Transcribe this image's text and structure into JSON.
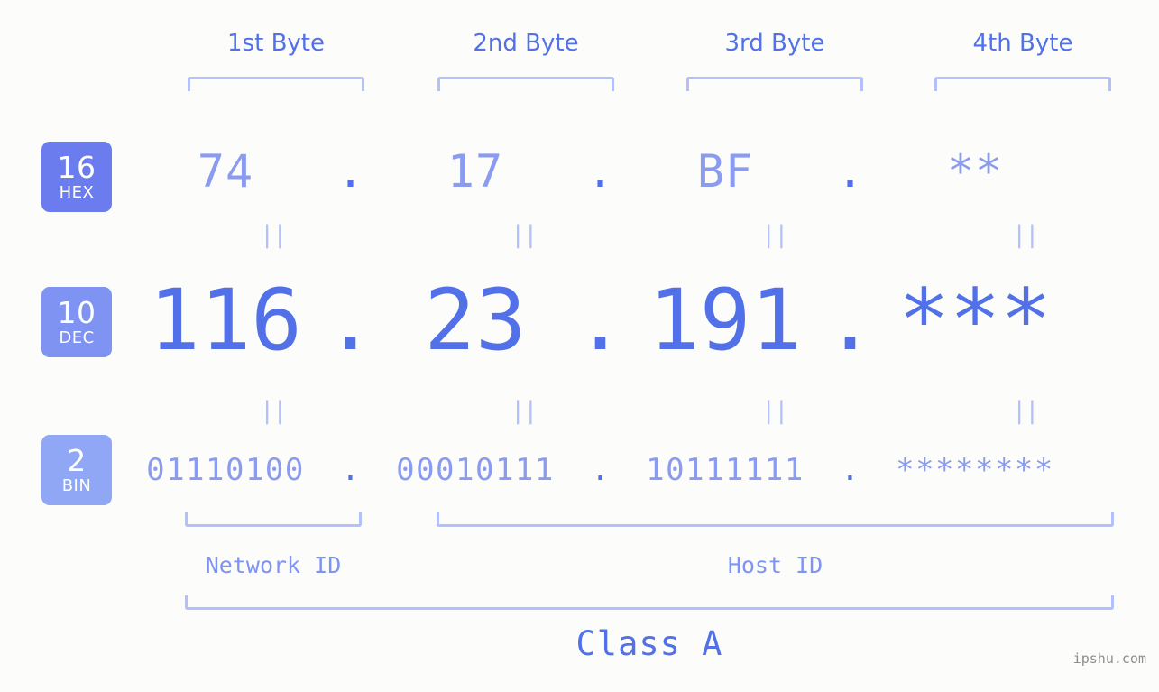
{
  "background_color": "#fcfdfa",
  "accent_colors": {
    "strong_blue": "#5271e8",
    "light_blue": "#8a9bf0",
    "bracket_blue": "#b3c0fb",
    "badge_hex": "#6b7cee",
    "badge_dec": "#7f93f2",
    "badge_bin": "#8fa7f5",
    "watermark_gray": "#8d8d8d"
  },
  "byte_headers": [
    {
      "label": "1st Byte"
    },
    {
      "label": "2nd Byte"
    },
    {
      "label": "3rd Byte"
    },
    {
      "label": "4th Byte"
    }
  ],
  "radix_badges": [
    {
      "number": "16",
      "word": "HEX",
      "color": "#6b7cee"
    },
    {
      "number": "10",
      "word": "DEC",
      "color": "#7f93f2"
    },
    {
      "number": "2",
      "word": "BIN",
      "color": "#8fa7f5"
    }
  ],
  "rows": {
    "hex": {
      "radix": "16",
      "radix_word": "HEX",
      "separator": ".",
      "octets": [
        "74",
        "17",
        "BF",
        "**"
      ]
    },
    "dec": {
      "radix": "10",
      "radix_word": "DEC",
      "separator": ".",
      "octets": [
        "116",
        "23",
        "191",
        "***"
      ]
    },
    "bin": {
      "radix": "2",
      "radix_word": "BIN",
      "separator": ".",
      "octets": [
        "01110100",
        "00010111",
        "10111111",
        "********"
      ]
    }
  },
  "equality_marks": {
    "glyph": "||",
    "count_per_gap": 4
  },
  "segments": {
    "network_id": {
      "label": "Network ID",
      "bytes": "1"
    },
    "host_id": {
      "label": "Host ID",
      "bytes": "2-4"
    }
  },
  "class": {
    "label": "Class A"
  },
  "watermark": {
    "text": "ipshu.com"
  }
}
